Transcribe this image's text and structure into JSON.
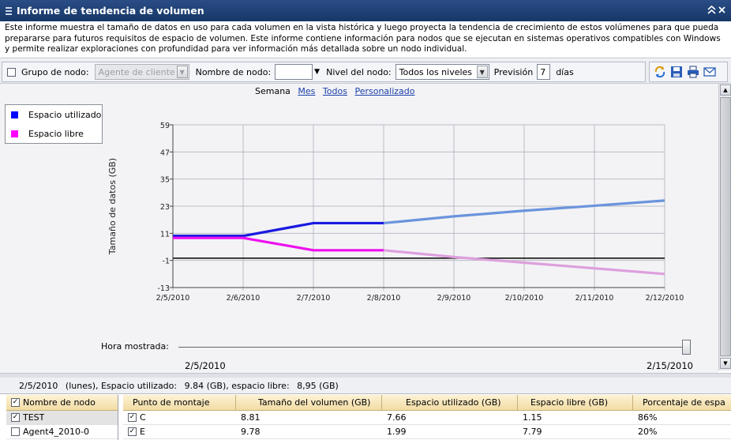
{
  "window": {
    "title": "Informe de tendencia de volumen"
  },
  "description": "Este informe muestra el tamaño de datos en uso para cada volumen en la vista histórica y luego proyecta la tendencia de crecimiento de estos volúmenes para que pueda prepararse para futuros requisitos de espacio de volumen. Este informe contiene información para nodos que se ejecutan en sistemas operativos compatibles con Windows y permite realizar exploraciones con profundidad para ver información más detallada sobre un nodo individual.",
  "filters": {
    "node_group_label": "Grupo de nodo:",
    "node_group_value": "Agente de cliente",
    "node_name_label": "Nombre de nodo:",
    "node_name_value": "",
    "node_level_label": "Nivel del nodo:",
    "node_level_value": "Todos los niveles",
    "forecast_label": "Previsión",
    "forecast_value": "7",
    "forecast_unit": "días"
  },
  "toolbar_icons": [
    "refresh-icon",
    "save-icon",
    "print-icon",
    "email-icon"
  ],
  "period": {
    "current": "Semana",
    "links": [
      "Mes",
      "Todos",
      "Personalizado"
    ]
  },
  "legend": [
    {
      "label": "Espacio utilizado",
      "color": "#0000ff"
    },
    {
      "label": "Espacio libre",
      "color": "#ff00ff"
    }
  ],
  "chart_data": {
    "type": "line",
    "title": "",
    "ylabel": "Tamaño de datos (GB)",
    "xlabel": "",
    "ylim": [
      -13,
      59
    ],
    "yticks": [
      59,
      47,
      35,
      23,
      11,
      -1,
      -13
    ],
    "categories": [
      "2/5/2010",
      "2/6/2010",
      "2/7/2010",
      "2/8/2010",
      "2/9/2010",
      "2/10/2010",
      "2/11/2010",
      "2/12/2010"
    ],
    "series": [
      {
        "name": "Espacio utilizado",
        "color": "#1a1ae0",
        "values": [
          9.84,
          9.84,
          15.5,
          15.5,
          null,
          null,
          null,
          null
        ]
      },
      {
        "name": "Espacio libre",
        "color": "#ee10ee",
        "values": [
          8.95,
          8.95,
          3.5,
          3.5,
          null,
          null,
          null,
          null
        ]
      },
      {
        "name": "Espacio utilizado",
        "color": "#6b94dc",
        "values": [
          null,
          null,
          null,
          15.5,
          18.5,
          21,
          23.2,
          25.5
        ]
      },
      {
        "name": "Espacio libre",
        "color": "#dda0dd",
        "values": [
          null,
          null,
          null,
          3.5,
          0.5,
          -2,
          -4.5,
          -7
        ]
      }
    ],
    "reference_line": 0,
    "grid": true
  },
  "time_slider": {
    "label": "Hora mostrada:",
    "start": "2/5/2010",
    "end": "2/15/2010",
    "position": 1.0
  },
  "status": {
    "date": "2/5/2010",
    "day": "(lunes), Espacio utilizado:",
    "used": "9.84 (GB), espacio libre:",
    "free": "8,95 (GB)"
  },
  "nodes_grid": {
    "header": "Nombre de nodo",
    "rows": [
      {
        "name": "TEST",
        "checked": true
      },
      {
        "name": "Agent4_2010-0",
        "checked": false
      }
    ]
  },
  "volumes_grid": {
    "headers": [
      "Punto de montaje",
      "Tamaño del volumen (GB)",
      "Espacio utilizado (GB)",
      "Espacio libre (GB)",
      "Porcentaje de espa"
    ],
    "rows": [
      {
        "mount": "C",
        "size": "8.81",
        "used": "7.66",
        "free": "1.15",
        "pct": "86%"
      },
      {
        "mount": "E",
        "size": "9.78",
        "used": "1.99",
        "free": "7.79",
        "pct": "20%"
      }
    ]
  }
}
